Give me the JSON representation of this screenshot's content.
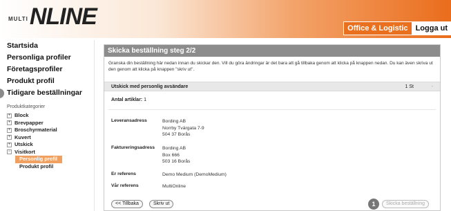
{
  "header": {
    "logo_small": "MULTI",
    "logo_main": "NLINE",
    "nav": [
      {
        "label": "Office & Logistic",
        "active": true
      },
      {
        "label": "Logga ut",
        "active": false
      }
    ]
  },
  "sidebar": {
    "items": [
      {
        "label": "Startsida"
      },
      {
        "label": "Personliga profiler"
      },
      {
        "label": "Företagsprofiler"
      },
      {
        "label": "Produkt profil"
      },
      {
        "label": "Tidigare beställningar"
      }
    ],
    "categories_title": "Produktkategorier",
    "categories": [
      {
        "label": "Block",
        "expander": "+"
      },
      {
        "label": "Brevpapper",
        "expander": "+"
      },
      {
        "label": "Broschyrmaterial",
        "expander": "+"
      },
      {
        "label": "Kuvert",
        "expander": "+"
      },
      {
        "label": "Utskick",
        "expander": "+"
      },
      {
        "label": "Visitkort",
        "expander": "−"
      }
    ],
    "subcategories": [
      {
        "label": "Personlig profil",
        "active": true
      },
      {
        "label": "Produkt profil",
        "active": false
      }
    ]
  },
  "main": {
    "title": "Skicka beställning steg 2/2",
    "intro": "Granska din beställning här nedan innan du skickar den. Vill du göra ändringar är det bara att gå tillbaka genom att klicka på knappen nedan. Du kan även skriva ut den genom att klicka på knappen \"skriv ut\".",
    "order_item": {
      "name": "Utskick med personlig avsändare",
      "qty": "1 St",
      "remove": "-"
    },
    "article_count_label": "Antal artiklar:",
    "article_count": "1",
    "delivery_label": "Leveransadress",
    "delivery_lines": [
      "Bording AB",
      "Norrby Tvärgata 7-9",
      "504 37 Borås"
    ],
    "billing_label": "Faktureringsadress",
    "billing_lines": [
      "Bording AB",
      "Box 666",
      "503 16 Borås"
    ],
    "your_ref_label": "Er referens",
    "your_ref": "Demo Medium (DemoMedium)",
    "our_ref_label": "Vår referens",
    "our_ref": "MultiOnline",
    "buttons": {
      "back": "<< Tillbaka",
      "print": "Skriv ut",
      "send": "Skicka beställning"
    },
    "step_badge": "1"
  }
}
